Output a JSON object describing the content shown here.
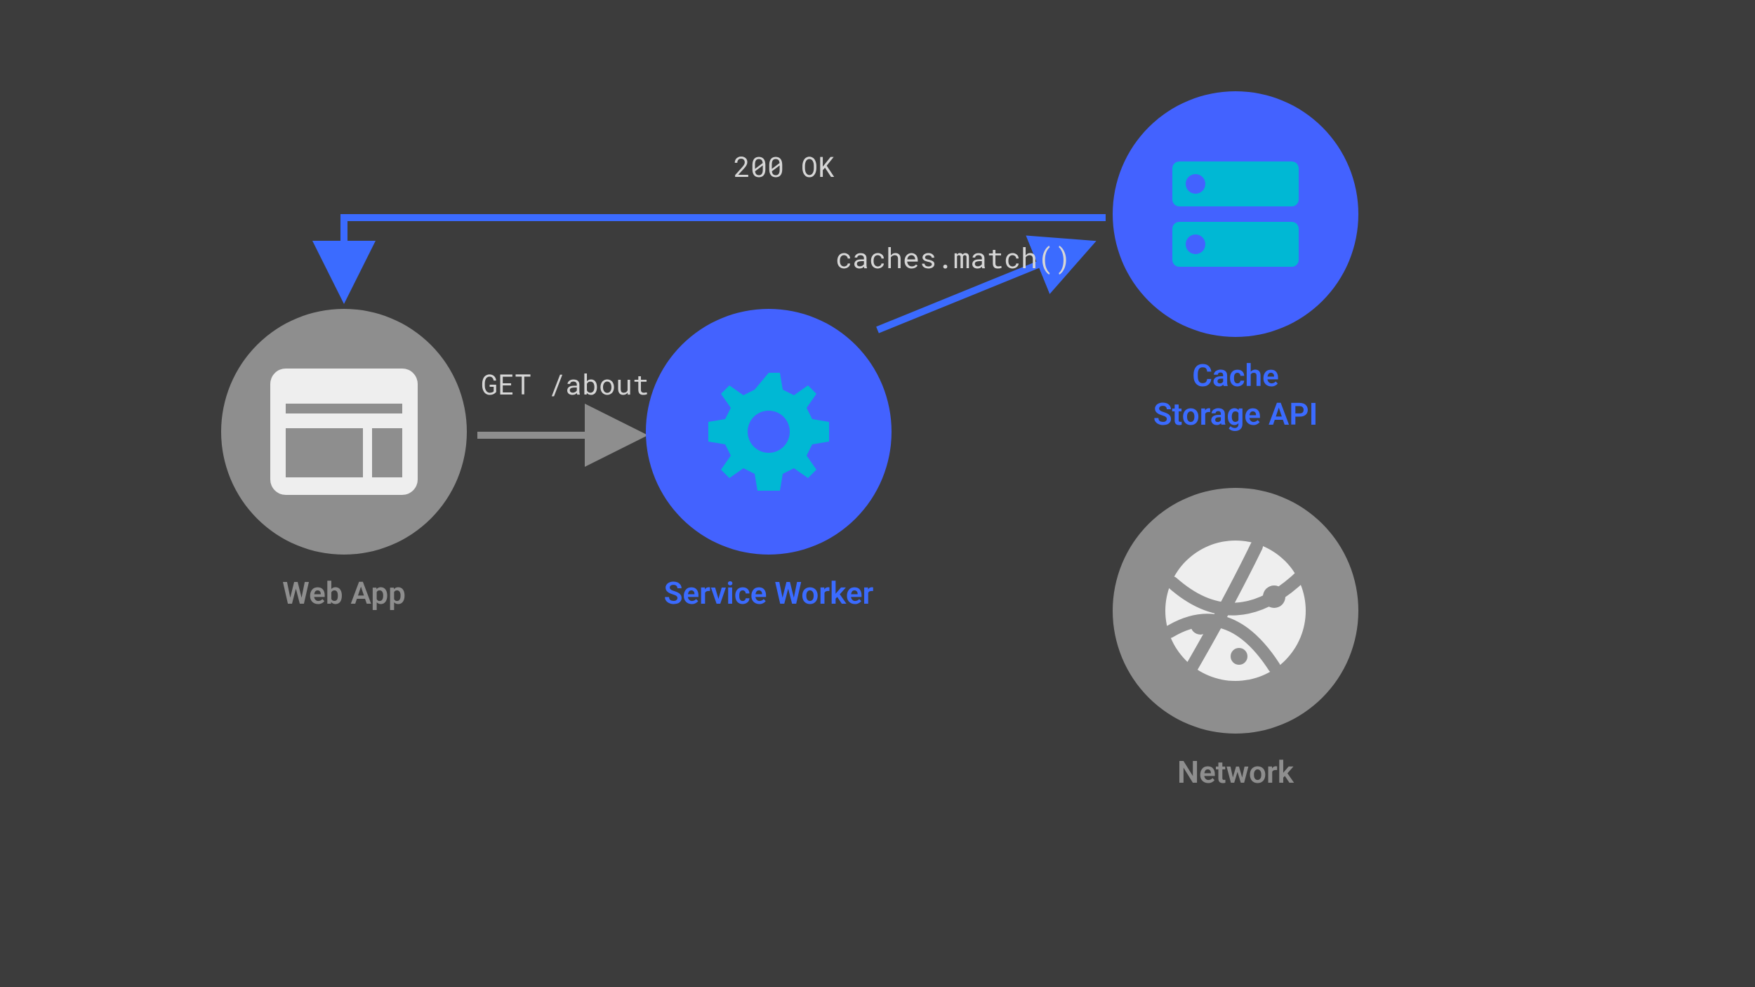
{
  "nodes": {
    "web_app": {
      "label": "Web App"
    },
    "service_worker": {
      "label": "Service Worker"
    },
    "cache_storage": {
      "label": "Cache\nStorage API"
    },
    "network": {
      "label": "Network"
    }
  },
  "arrows": {
    "get_about": {
      "label": "GET /about"
    },
    "caches_match": {
      "label": "caches.match()"
    },
    "ok_200": {
      "label": "200 OK"
    }
  },
  "colors": {
    "bg": "#3c3c3c",
    "gray": "#8e8e8e",
    "blue_node": "#4362ff",
    "blue_arrow": "#3b6bff",
    "cyan": "#00b8d4",
    "offwhite": "#eeeeee",
    "text": "#d6d6d6"
  }
}
